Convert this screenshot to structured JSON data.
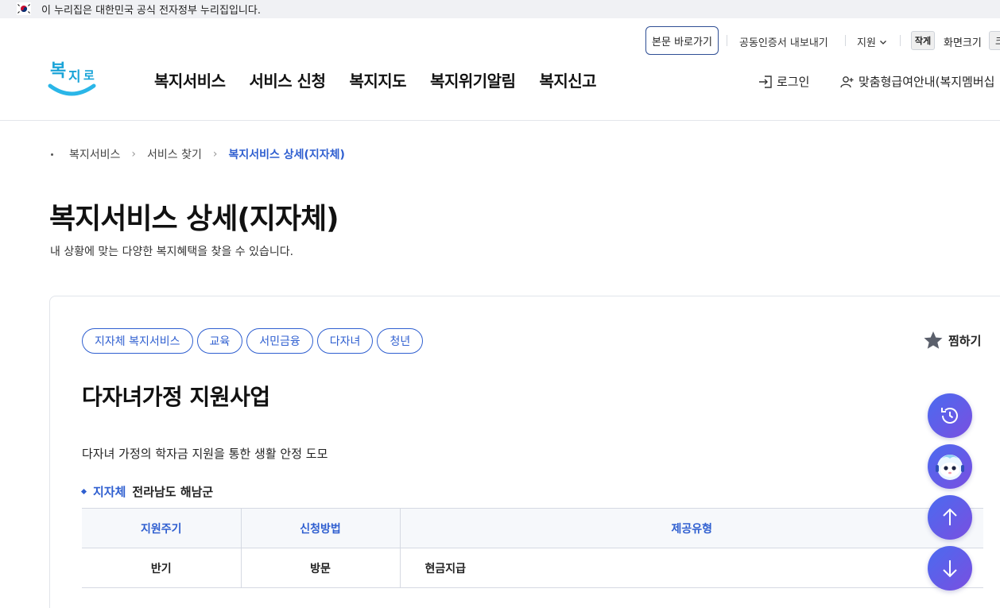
{
  "gov_banner": {
    "text": "이 누리집은 대한민국 공식 전자정부 누리집입니다."
  },
  "utility": {
    "skip_to_content": "본문 바로가기",
    "cert_export": "공동인증서 내보내기",
    "support": "지원",
    "font_small": "작게",
    "font_size_label": "화면크기",
    "font_large": "크"
  },
  "header": {
    "logo_text": "복지로",
    "nav": [
      "복지서비스",
      "서비스 신청",
      "복지지도",
      "복지위기알림",
      "복지신고"
    ],
    "login": "로그인",
    "member": "맞춤형급여안내(복지멤버십"
  },
  "breadcrumb": {
    "items": [
      "복지서비스",
      "서비스 찾기"
    ],
    "current": "복지서비스 상세(지자체)"
  },
  "page": {
    "title": "복지서비스 상세(지자체)",
    "description": "내 상황에 맞는 다양한 복지혜택을 찾을 수 있습니다."
  },
  "service": {
    "tags": [
      "지자체 복지서비스",
      "교육",
      "서민금융",
      "다자녀",
      "청년"
    ],
    "bookmark": "찜하기",
    "title": "다자녀가정 지원사업",
    "description": "다자녀 가정의 학자금 지원을 통한 생활 안정 도모",
    "region_label": "지자체",
    "region_value": "전라남도 해남군",
    "table": {
      "headers": [
        "지원주기",
        "신청방법",
        "제공유형"
      ],
      "rows": [
        [
          "반기",
          "방문",
          "현금지급"
        ]
      ]
    }
  },
  "colors": {
    "accent": "#2f5fd0",
    "fab_gradient_start": "#4a6bf0",
    "fab_gradient_end": "#7a4fe0"
  },
  "floating_buttons": [
    "history-icon",
    "chatbot-icon",
    "arrow-up-icon",
    "arrow-down-icon"
  ]
}
